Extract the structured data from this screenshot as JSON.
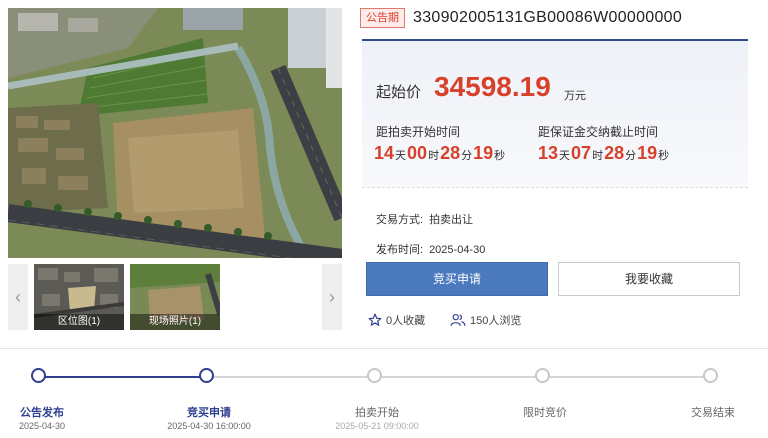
{
  "gallery": {
    "thumbnails": [
      {
        "caption": "区位图(1)"
      },
      {
        "caption": "现场照片(1)"
      }
    ]
  },
  "listing": {
    "badge": "公告期",
    "code": "330902005131GB00086W00000000",
    "start_price_label": "起始价",
    "start_price": "34598.19",
    "start_price_unit": "万元",
    "auction_countdown": {
      "label": "距拍卖开始时间",
      "days": "14",
      "hours": "00",
      "minutes": "28",
      "seconds": "19"
    },
    "deposit_countdown": {
      "label": "距保证金交纳截止时间",
      "days": "13",
      "hours": "07",
      "minutes": "28",
      "seconds": "19"
    },
    "units": {
      "day": "天",
      "hour": "时",
      "minute": "分",
      "second": "秒"
    },
    "trade_method_label": "交易方式:",
    "trade_method": "拍卖出让",
    "publish_time_label": "发布时间:",
    "publish_time": "2025-04-30",
    "apply_button": "竞买申请",
    "favorite_button": "我要收藏",
    "favorites": "0人收藏",
    "views": "150人浏览"
  },
  "progress": {
    "current_step": 2,
    "steps": [
      {
        "name": "公告发布",
        "date": "2025-04-30"
      },
      {
        "name": "竞买申请",
        "date": "2025-04-30 16:00:00"
      },
      {
        "name": "拍卖开始",
        "date": "2025-05-21 09:00:00"
      },
      {
        "name": "限时竞价",
        "date": ""
      },
      {
        "name": "交易结束",
        "date": ""
      }
    ]
  },
  "colors": {
    "accent_red": "#d9402b",
    "accent_blue": "#4a79bd",
    "navy": "#2f3f8f"
  },
  "icons": {
    "favorite": "star-outline-icon",
    "views": "people-icon",
    "prev": "chevron-left-icon",
    "next": "chevron-right-icon"
  }
}
